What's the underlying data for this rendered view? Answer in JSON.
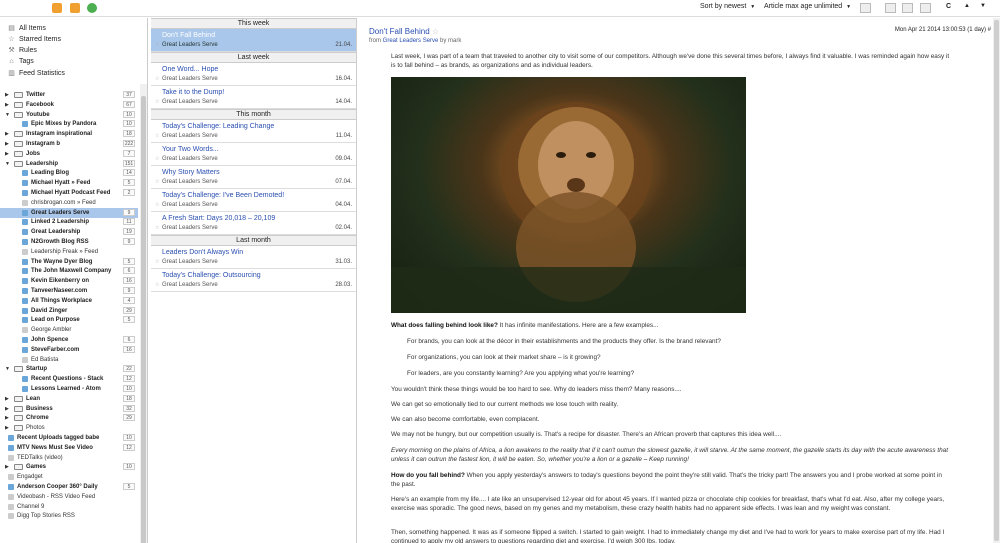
{
  "toolbar": {
    "sort_label": "Sort by newest",
    "age_label": "Article max age unlimited",
    "dropdown_arrow": "▼",
    "reload": "C",
    "up": "▲",
    "down": "▼"
  },
  "sidebar": {
    "top_items": [
      {
        "icon": "all-items-icon",
        "label": "All Items"
      },
      {
        "icon": "star-icon",
        "label": "Starred Items"
      },
      {
        "icon": "wrench-icon",
        "label": "Rules"
      },
      {
        "icon": "tag-icon",
        "label": "Tags"
      },
      {
        "icon": "stats-icon",
        "label": "Feed Statistics"
      }
    ],
    "tree": [
      {
        "type": "folder",
        "label": "Twitter",
        "count": "37",
        "expanded": false
      },
      {
        "type": "folder",
        "label": "Facebook",
        "count": "67",
        "expanded": false
      },
      {
        "type": "folder",
        "label": "Youtube",
        "count": "10",
        "expanded": true
      },
      {
        "type": "feed",
        "label": "Epic Mixes by Pandora",
        "count": "10",
        "indent": 1
      },
      {
        "type": "folder",
        "label": "Instagram inspirational",
        "count": "18",
        "expanded": false
      },
      {
        "type": "folder",
        "label": "Instagram b",
        "count": "222",
        "expanded": false
      },
      {
        "type": "folder",
        "label": "Jobs",
        "count": "7",
        "expanded": false
      },
      {
        "type": "folder",
        "label": "Leadership",
        "count": "151",
        "expanded": true
      },
      {
        "type": "feed",
        "label": "Leading Blog",
        "count": "14",
        "indent": 1
      },
      {
        "type": "feed",
        "label": "Michael Hyatt » Feed",
        "count": "5",
        "indent": 1
      },
      {
        "type": "feed",
        "label": "Michael Hyatt Podcast Feed",
        "count": "2",
        "indent": 1
      },
      {
        "type": "feedg",
        "label": "chrisbrogan.com » Feed",
        "count": "",
        "indent": 1
      },
      {
        "type": "feed",
        "label": "Great Leaders Serve",
        "count": "9",
        "indent": 1,
        "selected": true
      },
      {
        "type": "feed",
        "label": "Linked 2 Leadership",
        "count": "11",
        "indent": 1
      },
      {
        "type": "feed",
        "label": "Great Leadership",
        "count": "19",
        "indent": 1
      },
      {
        "type": "feed",
        "label": "N2Growth Blog RSS",
        "count": "9",
        "indent": 1
      },
      {
        "type": "feedg",
        "label": "Leadership Freak » Feed",
        "count": "",
        "indent": 1
      },
      {
        "type": "feed",
        "label": "The Wayne Dyer Blog",
        "count": "5",
        "indent": 1
      },
      {
        "type": "feed",
        "label": "The John Maxwell Company",
        "count": "6",
        "indent": 1
      },
      {
        "type": "feed",
        "label": "Kevin Eikenberry on",
        "count": "16",
        "indent": 1
      },
      {
        "type": "feed",
        "label": "TanveerNaseer.com",
        "count": "9",
        "indent": 1
      },
      {
        "type": "feed",
        "label": "All Things Workplace",
        "count": "4",
        "indent": 1
      },
      {
        "type": "feed",
        "label": "David Zinger",
        "count": "29",
        "indent": 1
      },
      {
        "type": "feed",
        "label": "Lead on Purpose",
        "count": "5",
        "indent": 1
      },
      {
        "type": "feedg",
        "label": "George Ambler",
        "count": "",
        "indent": 1
      },
      {
        "type": "feed",
        "label": "John Spence",
        "count": "6",
        "indent": 1
      },
      {
        "type": "feed",
        "label": "SteveFarber.com",
        "count": "16",
        "indent": 1
      },
      {
        "type": "feedg",
        "label": "Ed Batista",
        "count": "",
        "indent": 1
      },
      {
        "type": "folder",
        "label": "Startup",
        "count": "22",
        "expanded": true
      },
      {
        "type": "feed",
        "label": "Recent Questions - Stack",
        "count": "12",
        "indent": 1
      },
      {
        "type": "feed",
        "label": "Lessons Learned - Atom",
        "count": "10",
        "indent": 1
      },
      {
        "type": "folder",
        "label": "Lean",
        "count": "18",
        "expanded": false
      },
      {
        "type": "folder",
        "label": "Business",
        "count": "32",
        "expanded": false
      },
      {
        "type": "folder",
        "label": "Chrome",
        "count": "29",
        "expanded": false
      },
      {
        "type": "folderg",
        "label": "Photos",
        "count": "",
        "expanded": false
      },
      {
        "type": "feed",
        "label": "Recent Uploads tagged babe",
        "count": "10",
        "indent": 0
      },
      {
        "type": "feed",
        "label": "MTV News Must See Video",
        "count": "12",
        "indent": 0
      },
      {
        "type": "feedg",
        "label": "TEDTalks (video)",
        "count": "",
        "indent": 0
      },
      {
        "type": "folder",
        "label": "Games",
        "count": "10",
        "expanded": false
      },
      {
        "type": "feedg",
        "label": "Engadget",
        "count": "",
        "indent": 0
      },
      {
        "type": "feed",
        "label": "Anderson Cooper 360° Daily",
        "count": "5",
        "indent": 0
      },
      {
        "type": "feedg",
        "label": "Videobash - RSS Video Feed",
        "count": "",
        "indent": 0
      },
      {
        "type": "feedg",
        "label": "Channel 9",
        "count": "",
        "indent": 0
      },
      {
        "type": "feedg",
        "label": "Digg Top Stories RSS",
        "count": "",
        "indent": 0
      }
    ]
  },
  "articles": {
    "groups": [
      {
        "label": "This week",
        "items": [
          {
            "title": "Don't Fall Behind",
            "source": "Great Leaders Serve",
            "date": "21.04.",
            "selected": true
          }
        ]
      },
      {
        "label": "Last week",
        "items": [
          {
            "title": "One Word... Hope",
            "source": "Great Leaders Serve",
            "date": "16.04."
          },
          {
            "title": "Take it to the Dump!",
            "source": "Great Leaders Serve",
            "date": "14.04."
          }
        ]
      },
      {
        "label": "This month",
        "items": [
          {
            "title": "Today's Challenge: Leading Change",
            "source": "Great Leaders Serve",
            "date": "11.04."
          },
          {
            "title": "Your Two Words...",
            "source": "Great Leaders Serve",
            "date": "09.04."
          },
          {
            "title": "Why Story Matters",
            "source": "Great Leaders Serve",
            "date": "07.04."
          },
          {
            "title": "Today's Challenge: I've Been Demoted!",
            "source": "Great Leaders Serve",
            "date": "04.04."
          },
          {
            "title": "A Fresh Start: Days 20,018 – 20,109",
            "source": "Great Leaders Serve",
            "date": "02.04."
          }
        ]
      },
      {
        "label": "Last month",
        "items": [
          {
            "title": "Leaders Don't Always Win",
            "source": "Great Leaders Serve",
            "date": "31.03."
          },
          {
            "title": "Today's Challenge: Outsourcing",
            "source": "Great Leaders Serve",
            "date": "28.03."
          }
        ]
      }
    ]
  },
  "reader": {
    "title": "Don't Fall Behind",
    "from_prefix": "from",
    "from_feed": "Great Leaders Serve",
    "by": "by mark",
    "date": "Mon Apr 21 2014 13:00:53 (1 day) # 1",
    "paragraphs": [
      {
        "text": "Last week, I was part of a team that traveled to another city to visit some of our competitors. Although we've done this several times before, I always find it valuable. I was reminded again how easy it is to fall behind – as brands, as organizations and as individual leaders.",
        "style": ""
      },
      {
        "bold": "What does falling behind look like?",
        "text": " It has infinite manifestations. Here are a few examples...",
        "style": ""
      },
      {
        "text": "For brands, you can look at the décor in their establishments and the products they offer. Is the brand relevant?",
        "style": "ind"
      },
      {
        "text": "For organizations, you can look at their market share – is it growing?",
        "style": "ind"
      },
      {
        "text": "For leaders, are you constantly learning? Are you applying what you're learning?",
        "style": "ind"
      },
      {
        "text": "You wouldn't think these things would be too hard to see. Why do leaders miss them? Many reasons....",
        "style": ""
      },
      {
        "text": "We can get so emotionally tied to our current methods we lose touch with reality.",
        "style": ""
      },
      {
        "text": "We can also become comfortable, even complacent.",
        "style": ""
      },
      {
        "text": "We may not be hungry, but our competition usually is. That's a recipe for disaster. There's an African proverb that captures this idea well....",
        "style": ""
      },
      {
        "text": "Every morning on the plains of Africa, a lion awakens to the reality that if it can't outrun the slowest gazelle, it will starve. At the same moment, the gazelle starts its day with the acute awareness that unless it can outrun the fastest lion, it will be eaten. So, whether you're a lion or a gazelle – Keep running!",
        "style": "i"
      },
      {
        "bold": "How do you fall behind?",
        "text": " When you apply yesterday's answers to today's questions beyond the point they're still valid. That's the tricky part! The answers you and I probe worked at some point in the past.",
        "style": ""
      },
      {
        "text": "Here's an example from my life.... I ate like an unsupervised 12-year old for about 45 years. If I wanted pizza or chocolate chip cookies for breakfast, that's what I'd eat. Also, after my college years, exercise was sporadic. The good news, based on my genes and my metabolism, these crazy health habits had no apparent side effects. I was lean and my weight was constant.",
        "style": ""
      },
      {
        "text": "Then, something happened. It was as if someone flipped a switch. I started to gain weight. I had to immediately change my diet and I've had to work for years to make exercise part of my life. Had I continued to apply my old answers to questions regarding diet and exercise, I'd weigh 300 lbs. today.",
        "style": ""
      }
    ]
  }
}
